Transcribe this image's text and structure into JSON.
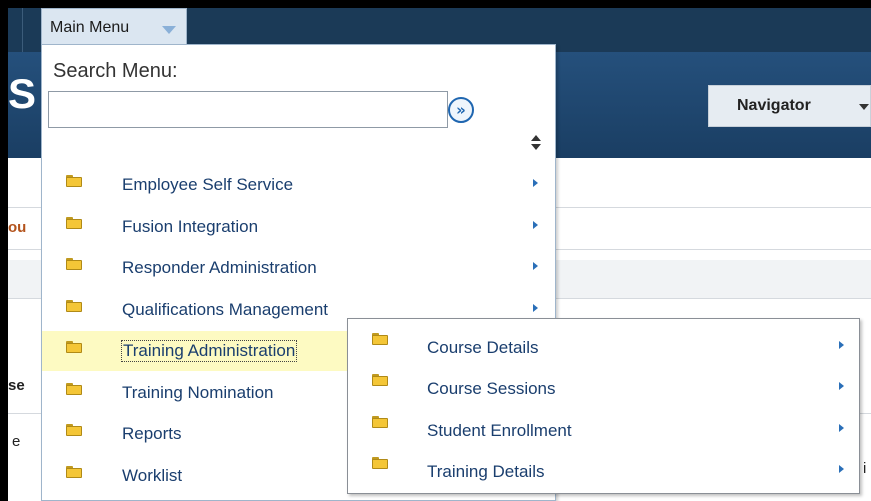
{
  "app": {
    "logo_fragment": "S",
    "navigator_label": "Navigator",
    "background_fragments": [
      "ou",
      "se",
      "e",
      "i"
    ]
  },
  "main_menu": {
    "tab_label": "Main Menu",
    "search_label": "Search Menu:",
    "search_value": "",
    "search_placeholder": "",
    "search_go_glyph": "»",
    "items": [
      {
        "label": "Employee Self Service",
        "icon": "folder-icon",
        "has_submenu": true
      },
      {
        "label": "Fusion Integration",
        "icon": "folder-icon",
        "has_submenu": true
      },
      {
        "label": "Responder Administration",
        "icon": "folder-icon",
        "has_submenu": true
      },
      {
        "label": "Qualifications Management",
        "icon": "folder-icon",
        "has_submenu": true
      },
      {
        "label": "Training Administration",
        "icon": "folder-icon",
        "has_submenu": true,
        "active": true
      },
      {
        "label": "Training Nomination",
        "icon": "folder-icon",
        "has_submenu": false
      },
      {
        "label": "Reports",
        "icon": "folder-icon",
        "has_submenu": false
      },
      {
        "label": "Worklist",
        "icon": "folder-icon",
        "has_submenu": false
      }
    ]
  },
  "submenu": {
    "items": [
      {
        "label": "Course Details",
        "icon": "folder-icon",
        "has_submenu": true
      },
      {
        "label": "Course Sessions",
        "icon": "folder-icon",
        "has_submenu": true
      },
      {
        "label": "Student Enrollment",
        "icon": "folder-icon",
        "has_submenu": true
      },
      {
        "label": "Training Details",
        "icon": "folder-icon",
        "has_submenu": true
      }
    ]
  },
  "colors": {
    "header_bg": "#1b3a57",
    "banner_bg": "#25507c",
    "link_text": "#1a3e6e",
    "active_row": "#fdfac2",
    "folder": "#f4c637",
    "arrow": "#2a6fb8"
  }
}
